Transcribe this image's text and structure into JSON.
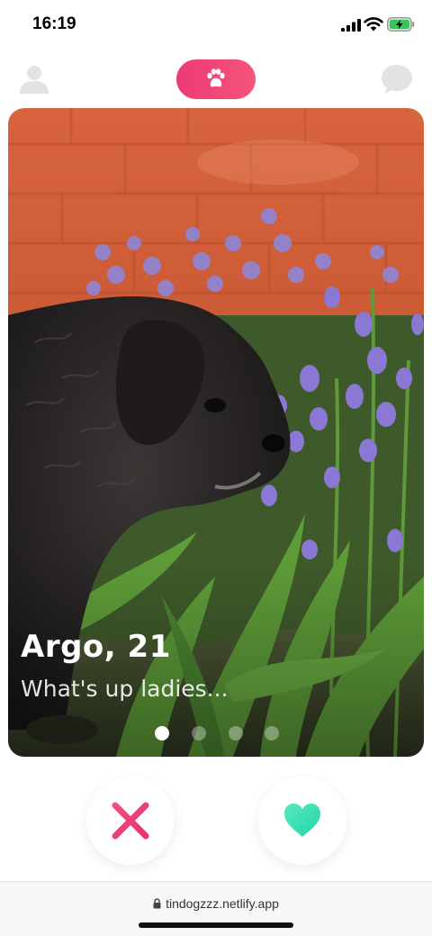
{
  "status_bar": {
    "time": "16:19",
    "icons": [
      "signal-icon",
      "wifi-icon",
      "battery-charging-icon"
    ],
    "battery_color": "#34c759"
  },
  "header": {
    "left_icon": "profile-icon",
    "logo_icon": "paw-icon",
    "right_icon": "chat-icon",
    "accent_color": "#ec3a76"
  },
  "card": {
    "name": "Argo, 21",
    "bio": "What's up ladies...",
    "photo_count": 4,
    "active_photo": 1
  },
  "actions": {
    "nope_icon": "close-x-icon",
    "like_icon": "heart-icon",
    "nope_color": "#ec3a76",
    "like_color": "#2fe0b0"
  },
  "browser": {
    "url": "tindogzzz.netlify.app"
  }
}
